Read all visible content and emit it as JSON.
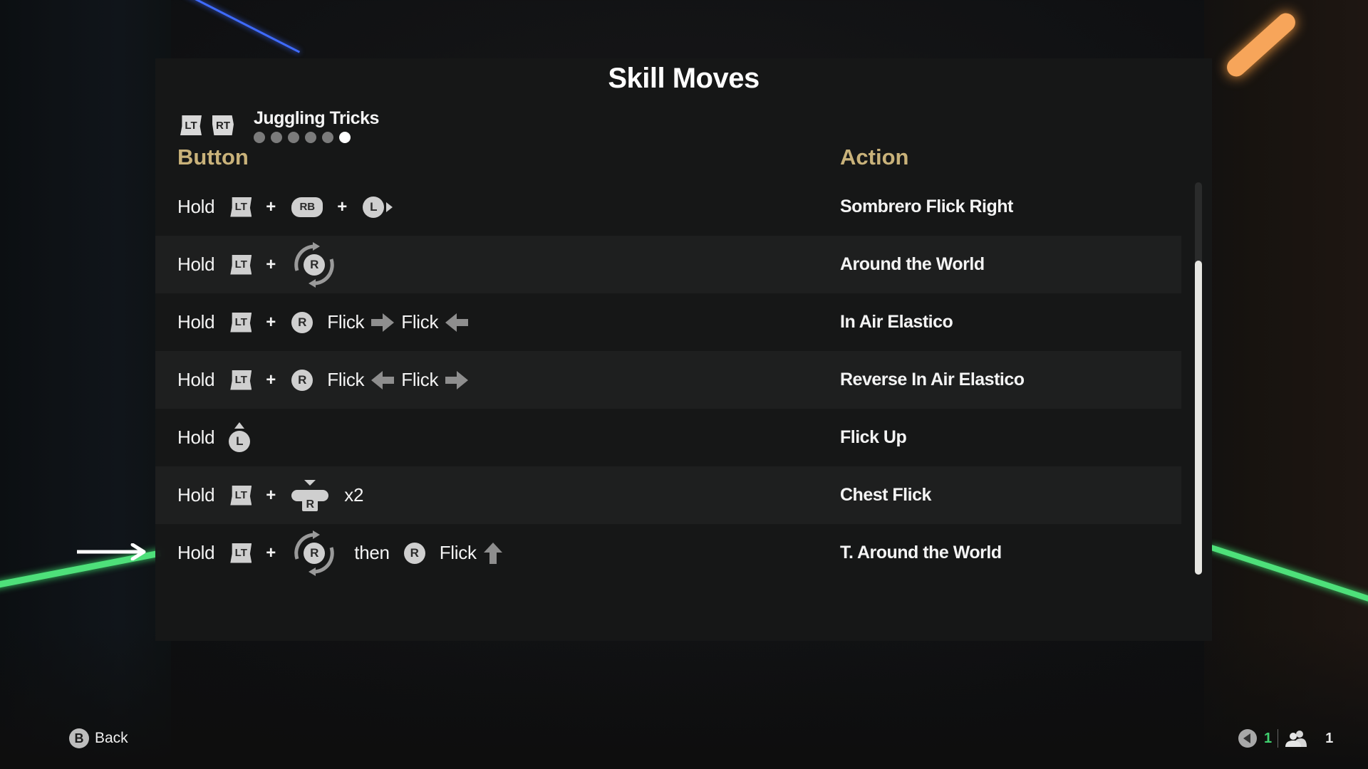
{
  "screen": {
    "title": "Skill Moves",
    "category": {
      "prev_trigger": "LT",
      "next_trigger": "RT",
      "name": "Juggling Tricks",
      "page_count": 6,
      "active_page": 6
    },
    "columns": {
      "button": "Button",
      "action": "Action"
    },
    "words": {
      "hold": "Hold",
      "plus": "+",
      "flick": "Flick",
      "then": "then",
      "x2": "x2"
    },
    "icons": {
      "lt": "LT",
      "rb": "RB",
      "l": "L",
      "r": "R"
    },
    "rows": [
      {
        "combo": "Hold LT + RB + L (right)",
        "action": "Sombrero Flick Right"
      },
      {
        "combo": "Hold LT + R (rotate)",
        "action": "Around the World"
      },
      {
        "combo": "Hold LT + R Flick right, Flick left",
        "action": "In Air Elastico"
      },
      {
        "combo": "Hold LT + R Flick left, Flick right",
        "action": "Reverse In Air Elastico"
      },
      {
        "combo": "Hold L (up)",
        "action": "Flick Up"
      },
      {
        "combo": "Hold LT + R (press down) x2",
        "action": "Chest Flick"
      },
      {
        "combo": "Hold LT + R (rotate) then R Flick up",
        "action": "T. Around the World"
      }
    ],
    "highlighted_row": 7,
    "scroll": {
      "thumb_start_fraction": 0.2,
      "thumb_end_fraction": 1.0
    }
  },
  "footer": {
    "back_button": "B",
    "back_label": "Back",
    "voice_count": "1",
    "party_count": "1"
  },
  "colors": {
    "header_gold": "#c9b27a",
    "voice_green": "#3fd06f"
  }
}
